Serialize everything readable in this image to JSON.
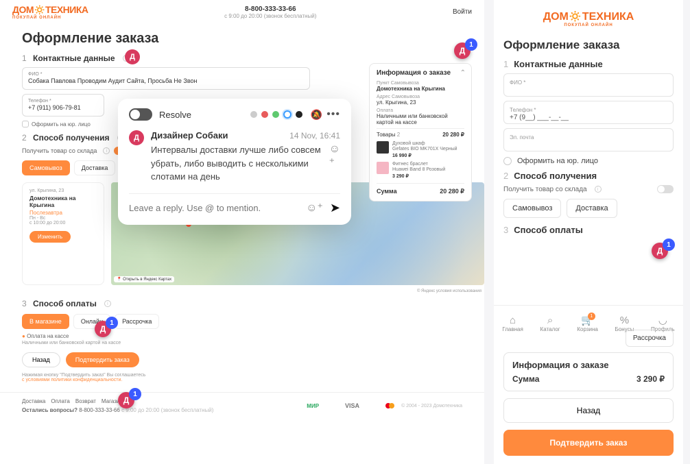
{
  "brand": {
    "name": "ДОМОТЕХНИКА",
    "tagline": "ПОКУПАЙ ОНЛАЙН"
  },
  "header": {
    "phone": "8-800-333-33-66",
    "hours": "с 9:00 до 20:00 (звонок бесплатный)",
    "login": "Войти"
  },
  "page_title": "Оформление заказа",
  "steps": {
    "s1": {
      "num": "1",
      "title": "Контактные данные"
    },
    "s2": {
      "num": "2",
      "title": "Способ получения"
    },
    "s3": {
      "num": "3",
      "title": "Способ оплаты"
    }
  },
  "fields": {
    "fio_label": "ФИО *",
    "fio_value": "Собака Павлова Проводим Аудит Сайта, Просьба Не Звон",
    "tel_label": "Телефон *",
    "tel_value": "+7 (911) 906-79-81",
    "email_label": "Эл. почта",
    "tel_placeholder": "+7 (9__) ___-__-__"
  },
  "checkbox_legal": "Оформить на юр. лицо",
  "stock_toggle": "Получить товар со склада",
  "delivery_tabs": {
    "pickup": "Самовывоз",
    "delivery": "Доставка"
  },
  "pickup": {
    "addr": "ул. Крыгина, 23",
    "name": "Домотехника на Крыгина",
    "soon": "Послезавтра",
    "days": "Пн - Вс",
    "hours": "с 10:00 до 20:00",
    "change": "Изменить"
  },
  "map": {
    "open": "Открыть в Яндекс Картах",
    "attr": "© Яндекс условия использования"
  },
  "pay_tabs": {
    "store": "В магазине",
    "online": "Онлайн",
    "installment": "Рассрочка"
  },
  "pay_note": {
    "title": "Оплата на кассе",
    "desc": "Наличными или банковской картой на кассе"
  },
  "buttons": {
    "back": "Назад",
    "submit": "Подтвердить заказ"
  },
  "legal": {
    "text": "Нажимая кнопку \"Подтвердить заказ\" Вы соглашаетесь",
    "link": "с условиями политики конфиденциальности."
  },
  "footer": {
    "links": [
      "Доставка",
      "Оплата",
      "Возврат",
      "Магазины"
    ],
    "question": "Остались вопросы?",
    "phone": "8-800-333-33-66",
    "hours": "с 9:00 до 20:00 (звонок бесплатный)",
    "visa": "VISA",
    "copy": "© 2004 - 2023 Домотехника"
  },
  "order": {
    "title": "Информация о заказе",
    "pickup_point_lbl": "Пункт Самовывоза",
    "pickup_point": "Домотехника на Крыгина",
    "addr_lbl": "Адрес Самовывоза",
    "addr": "ул. Крыгина, 23",
    "pay_lbl": "Оплата",
    "pay": "Наличными или банковской картой на кассе",
    "goods_lbl": "Товары",
    "goods_count": "2",
    "goods_sum": "20 280 ₽",
    "p1": {
      "cat": "Духовой шкаф",
      "name": "Gefates BIO MK701X Черный",
      "price": "16 990 ₽"
    },
    "p2": {
      "cat": "Фитнес браслет",
      "name": "Huawei Band 8 Розовый",
      "price": "3 290 ₽"
    },
    "sum_lbl": "Сумма",
    "sum": "20 280 ₽"
  },
  "right_sum": "3 290 ₽",
  "popup": {
    "resolve": "Resolve",
    "author": "Дизайнер Собаки",
    "date": "14 Nov, 16:41",
    "text": "Интервалы доставки лучше либо совсем убрать, либо выводить с несколькими слотами на день",
    "reply_placeholder": "Leave a reply. Use @ to mention."
  },
  "badge_letter": "Д",
  "badge_count": "1",
  "nav": {
    "home": "Главная",
    "catalog": "Каталог",
    "cart": "Корзина",
    "bonus": "Бонусы",
    "profile": "Профиль",
    "cart_count": "1"
  }
}
